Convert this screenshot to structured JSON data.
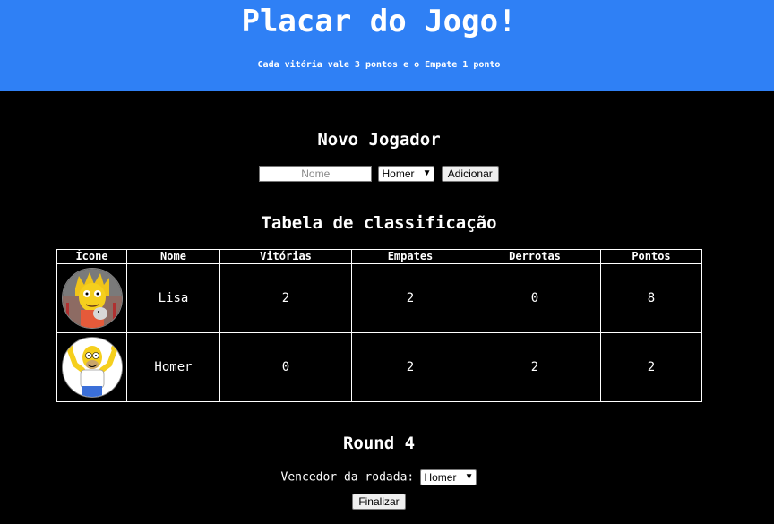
{
  "header": {
    "title": "Placar do Jogo!",
    "subtitle": "Cada vitória vale 3 pontos e o Empate 1 ponto",
    "bg_color": "#2f80f5"
  },
  "new_player": {
    "title": "Novo Jogador",
    "name_placeholder": "Nome",
    "select_value": "Homer",
    "add_label": "Adicionar"
  },
  "ranking": {
    "title": "Tabela de classificação",
    "columns": [
      "Ícone",
      "Nome",
      "Vitórias",
      "Empates",
      "Derrotas",
      "Pontos"
    ],
    "rows": [
      {
        "icon": "lisa-simpson-avatar",
        "name": "Lisa",
        "wins": "2",
        "draws": "2",
        "losses": "0",
        "points": "8"
      },
      {
        "icon": "homer-simpson-avatar",
        "name": "Homer",
        "wins": "0",
        "draws": "2",
        "losses": "2",
        "points": "2"
      }
    ]
  },
  "round": {
    "title": "Round 4",
    "winner_label": "Vencedor da rodada:",
    "winner_value": "Homer",
    "finish_label": "Finalizar"
  }
}
